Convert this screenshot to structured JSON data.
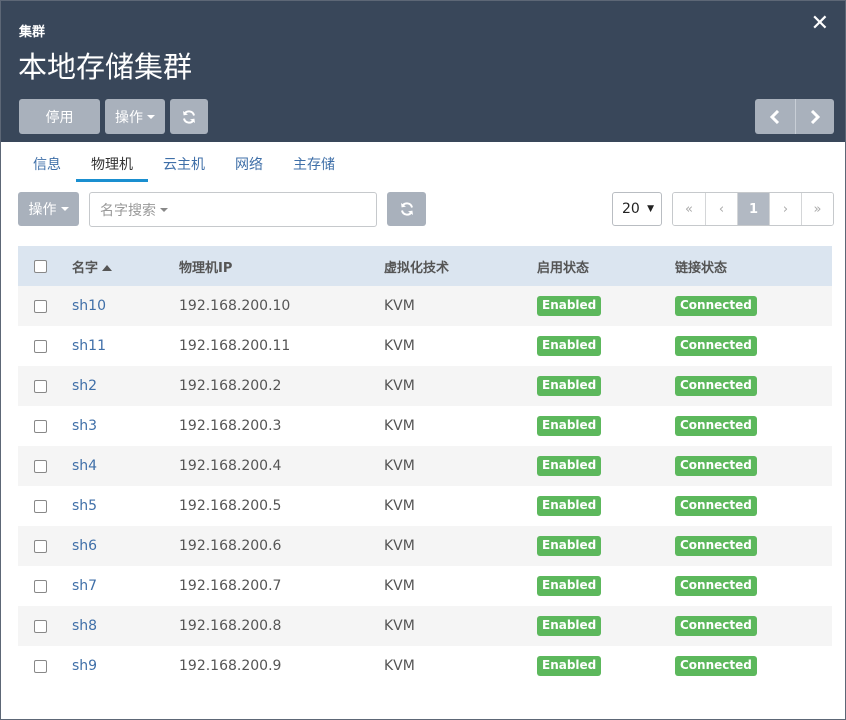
{
  "header": {
    "breadcrumb": "集群",
    "title": "本地存储集群",
    "buttons": {
      "disable": "停用",
      "operations": "操作"
    }
  },
  "tabs": [
    {
      "label": "信息",
      "active": false
    },
    {
      "label": "物理机",
      "active": true
    },
    {
      "label": "云主机",
      "active": false
    },
    {
      "label": "网络",
      "active": false
    },
    {
      "label": "主存储",
      "active": false
    }
  ],
  "toolbar": {
    "operations": "操作",
    "search_placeholder": "名字搜索",
    "page_size": "20",
    "pager": [
      "«",
      "‹",
      "1",
      "›",
      "»"
    ],
    "current_page": "1"
  },
  "table": {
    "columns": {
      "name": "名字",
      "ip": "物理机IP",
      "virt": "虚拟化技术",
      "enabled": "启用状态",
      "connected": "链接状态"
    },
    "rows": [
      {
        "name": "sh10",
        "ip": "192.168.200.10",
        "virt": "KVM",
        "enabled": "Enabled",
        "connected": "Connected"
      },
      {
        "name": "sh11",
        "ip": "192.168.200.11",
        "virt": "KVM",
        "enabled": "Enabled",
        "connected": "Connected"
      },
      {
        "name": "sh2",
        "ip": "192.168.200.2",
        "virt": "KVM",
        "enabled": "Enabled",
        "connected": "Connected"
      },
      {
        "name": "sh3",
        "ip": "192.168.200.3",
        "virt": "KVM",
        "enabled": "Enabled",
        "connected": "Connected"
      },
      {
        "name": "sh4",
        "ip": "192.168.200.4",
        "virt": "KVM",
        "enabled": "Enabled",
        "connected": "Connected"
      },
      {
        "name": "sh5",
        "ip": "192.168.200.5",
        "virt": "KVM",
        "enabled": "Enabled",
        "connected": "Connected"
      },
      {
        "name": "sh6",
        "ip": "192.168.200.6",
        "virt": "KVM",
        "enabled": "Enabled",
        "connected": "Connected"
      },
      {
        "name": "sh7",
        "ip": "192.168.200.7",
        "virt": "KVM",
        "enabled": "Enabled",
        "connected": "Connected"
      },
      {
        "name": "sh8",
        "ip": "192.168.200.8",
        "virt": "KVM",
        "enabled": "Enabled",
        "connected": "Connected"
      },
      {
        "name": "sh9",
        "ip": "192.168.200.9",
        "virt": "KVM",
        "enabled": "Enabled",
        "connected": "Connected"
      }
    ]
  },
  "colors": {
    "header_bg": "#39475a",
    "button_grey": "#a9b1bc",
    "link_blue": "#3f6fa8",
    "tab_underline": "#1a8fd0",
    "badge_green": "#5cb85c",
    "table_header_bg": "#dbe5f0"
  },
  "icons": [
    "close-icon",
    "refresh-icon",
    "chevron-left-icon",
    "chevron-right-icon",
    "caret-down-icon",
    "sort-asc-icon",
    "dropdown-arrow-icon"
  ]
}
